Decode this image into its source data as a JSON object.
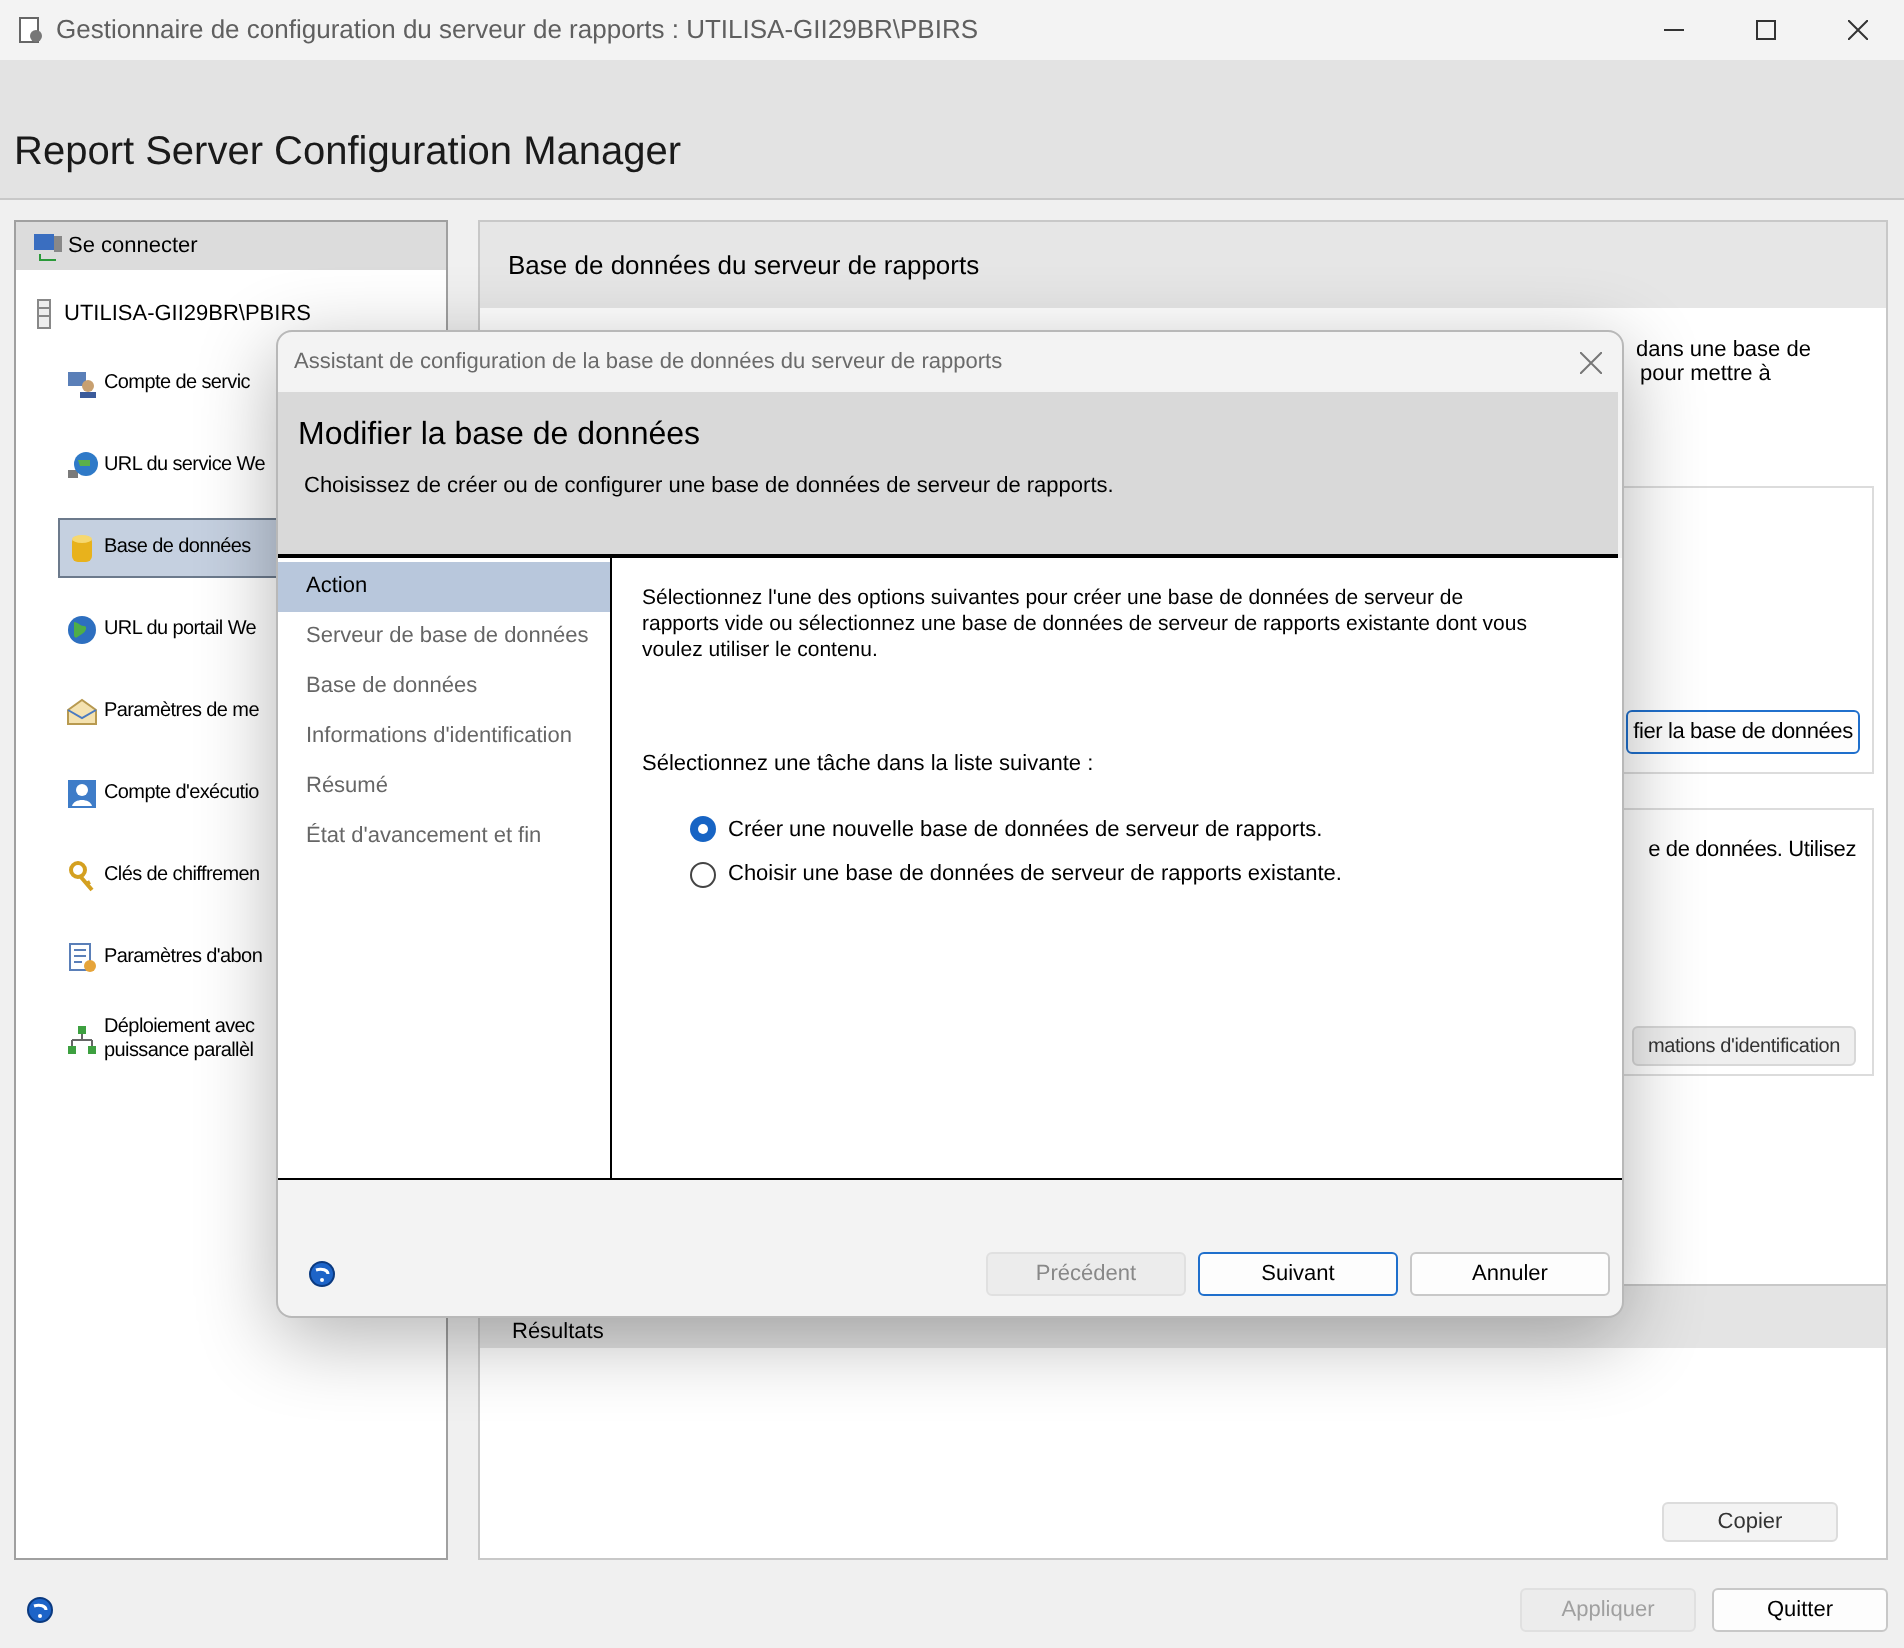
{
  "window": {
    "title": "Gestionnaire de configuration du serveur de rapports : UTILISA-GII29BR\\PBIRS",
    "app_title": "Report Server Configuration Manager"
  },
  "sidebar": {
    "connect": "Se connecter",
    "server": "UTILISA-GII29BR\\PBIRS",
    "items": [
      {
        "label": "Compte de servic",
        "selected": false
      },
      {
        "label": "URL du service We",
        "selected": false
      },
      {
        "label": "Base de données",
        "selected": true
      },
      {
        "label": "URL du portail We",
        "selected": false
      },
      {
        "label": "Paramètres de me",
        "selected": false
      },
      {
        "label": "Compte d'exécutio",
        "selected": false
      },
      {
        "label": "Clés de chiffremen",
        "selected": false
      },
      {
        "label": "Paramètres d'abon",
        "selected": false
      },
      {
        "label": "Déploiement avec\npuissance parallèl",
        "selected": false
      }
    ]
  },
  "main": {
    "header": "Base de données du serveur de rapports",
    "intro": [
      "dans une base de",
      "pour mettre à"
    ],
    "db_button": "fier la base de données",
    "section2_text": "e de données. Utilisez",
    "credentials_button": "mations d'identification",
    "results_header": "Résultats",
    "copy_button": "Copier"
  },
  "footer": {
    "apply": {
      "label": "Appliquer",
      "disabled": true
    },
    "quit": {
      "label": "Quitter",
      "disabled": false
    }
  },
  "dialog": {
    "title": "Assistant de configuration de la base de données du serveur de rapports",
    "heading": "Modifier la base de données",
    "subheading": "Choisissez de créer ou de configurer une base de données de serveur de rapports.",
    "steps": [
      {
        "label": "Action",
        "selected": true
      },
      {
        "label": "Serveur de base de données",
        "selected": false
      },
      {
        "label": "Base de données",
        "selected": false
      },
      {
        "label": "Informations d'identification",
        "selected": false
      },
      {
        "label": "Résumé",
        "selected": false
      },
      {
        "label": "État d'avancement et fin",
        "selected": false
      }
    ],
    "description": "Sélectionnez l'une des options suivantes pour créer une base de données de serveur de rapports vide ou sélectionnez une base de données de serveur de rapports existante dont vous voulez utiliser le contenu.",
    "task_label": "Sélectionnez une tâche dans la liste suivante :",
    "options": [
      {
        "label": "Créer une nouvelle base de données de serveur de rapports.",
        "selected": true
      },
      {
        "label": "Choisir une base de données de serveur de rapports existante.",
        "selected": false
      }
    ],
    "buttons": [
      {
        "label": "Précédent",
        "disabled": true,
        "default": false
      },
      {
        "label": "Suivant",
        "disabled": false,
        "default": true
      },
      {
        "label": "Annuler",
        "disabled": false,
        "default": false
      }
    ]
  }
}
